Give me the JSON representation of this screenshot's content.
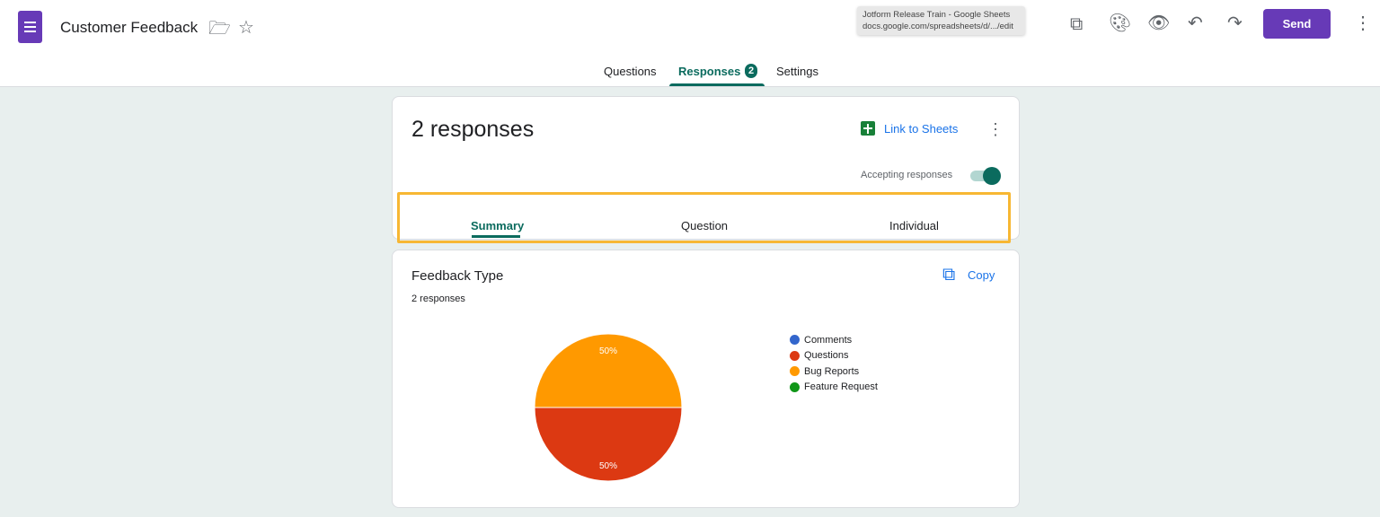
{
  "header": {
    "title": "Customer Feedback",
    "send_label": "Send"
  },
  "tooltip": {
    "line1": "Jotform Release Train - Google Sheets",
    "line2": "docs.google.com/spreadsheets/d/.../edit"
  },
  "tabs": [
    {
      "label": "Questions"
    },
    {
      "label": "Responses",
      "badge": "2"
    },
    {
      "label": "Settings"
    }
  ],
  "responses": {
    "count_title": "2 responses",
    "link_label": "Link to Sheets",
    "accepting_label": "Accepting responses",
    "accepting": true,
    "subtabs": [
      {
        "label": "Summary"
      },
      {
        "label": "Question"
      },
      {
        "label": "Individual"
      }
    ]
  },
  "question": {
    "title": "Feedback Type",
    "count": "2 responses",
    "copy_label": "Copy"
  },
  "chart_data": {
    "type": "pie",
    "title": "Feedback Type",
    "categories": [
      "Comments",
      "Questions",
      "Bug Reports",
      "Feature Request"
    ],
    "values": [
      0,
      1,
      1,
      0
    ],
    "colors": [
      "#3366cc",
      "#dc3912",
      "#ff9900",
      "#109618"
    ],
    "labels": [
      "50%",
      "50%"
    ],
    "legend": "right"
  }
}
